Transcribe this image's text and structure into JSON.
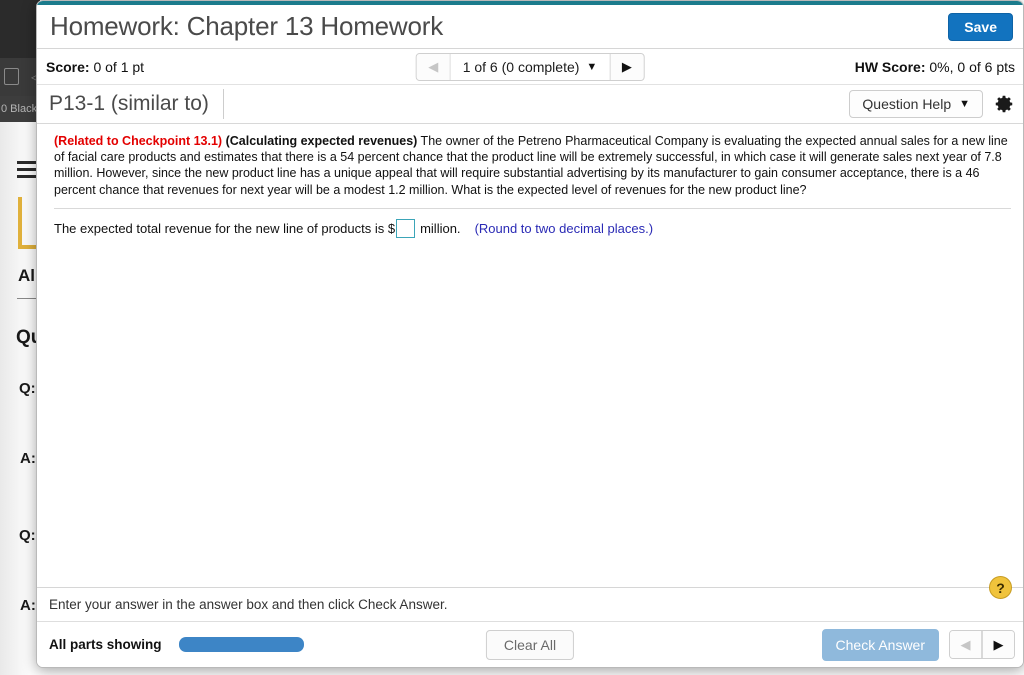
{
  "background": {
    "status_text": "0 Black",
    "fragments": [
      "All",
      "Qu",
      "Q:",
      "A:",
      "Q:",
      "A:"
    ]
  },
  "header": {
    "title": "Homework: Chapter 13 Homework",
    "save_label": "Save"
  },
  "scorebar": {
    "score_label": "Score:",
    "score_value": "0 of 1 pt",
    "nav_prev_icon": "◀",
    "nav_next_icon": "▶",
    "question_selector": "1 of 6 (0 complete)",
    "caret_icon": "▼",
    "hw_score_label": "HW Score:",
    "hw_score_value": "0%, 0 of 6 pts"
  },
  "question_bar": {
    "question_id": "P13-1 (similar to)",
    "question_help_label": "Question Help",
    "caret_icon": "▼",
    "gear_icon": "gear-icon"
  },
  "question": {
    "checkpoint": "(Related to Checkpoint 13.1)",
    "topic": "(Calculating expected revenues)",
    "text": " The owner of the Petreno Pharmaceutical Company is evaluating the expected annual sales for a new line of facial care products and estimates that there is a 54 percent chance that the product line will be extremely successful, in which case it will generate sales next year of 7.8 million. However, since the new product line has a unique appeal that will require substantial advertising by its manufacturer to gain consumer acceptance, there is a 46 percent chance that revenues for next year will be a modest 1.2 million. What is the expected level of revenues for the new product line?",
    "answer_prompt_pre": "The expected total revenue for the new line of products is $",
    "answer_value": "",
    "answer_prompt_post": "million.",
    "rounding_note": "(Round to two decimal places.)"
  },
  "footer": {
    "hint": "Enter your answer in the answer box and then click Check Answer.",
    "help_icon": "?",
    "parts_label": "All parts showing",
    "clear_label": "Clear All",
    "check_label": "Check Answer",
    "nav_prev_icon": "◀",
    "nav_next_icon": "▶"
  },
  "colors": {
    "accent_teal": "#1b7b8c",
    "save_blue": "#1273bf",
    "checkpoint_red": "#e30000",
    "note_blue": "#2a2ab5",
    "progress_blue": "#3d85c6",
    "check_blue": "#8fb9dc",
    "input_border": "#3ba5b8",
    "help_yellow": "#f0c33c"
  }
}
